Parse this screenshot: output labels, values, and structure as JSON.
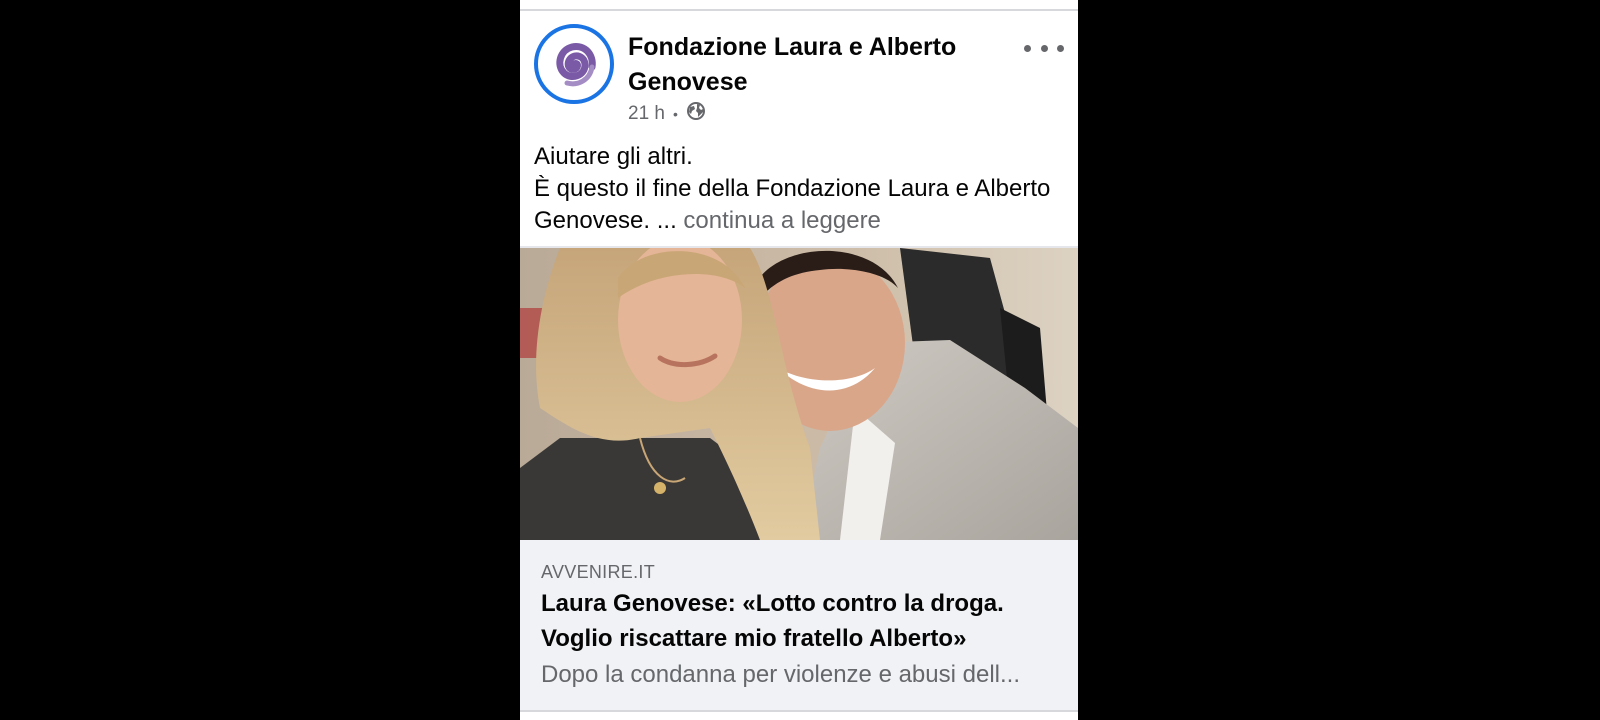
{
  "post": {
    "page_name": "Fondazione Laura e Alberto Genovese",
    "timestamp": "21 h",
    "separator": "•",
    "audience_icon": "globe-icon",
    "more_icon": "more-options-icon",
    "avatar_icon": "spiral-logo",
    "text_line1": "Aiutare gli altri.",
    "text_line2": "È questo il fine della Fondazione Laura e Alberto Genovese. ...",
    "see_more": "continua a leggere"
  },
  "link_preview": {
    "domain": "AVVENIRE.IT",
    "title": "Laura Genovese: «Lotto contro la droga. Voglio riscattare mio fratello Alberto»",
    "description": "Dopo la condanna per violenze e abusi dell..."
  },
  "colors": {
    "accent": "#1b74e4",
    "logo_purple": "#7a5aa6",
    "muted_text": "#65676b",
    "link_bg": "#f0f2f5"
  }
}
